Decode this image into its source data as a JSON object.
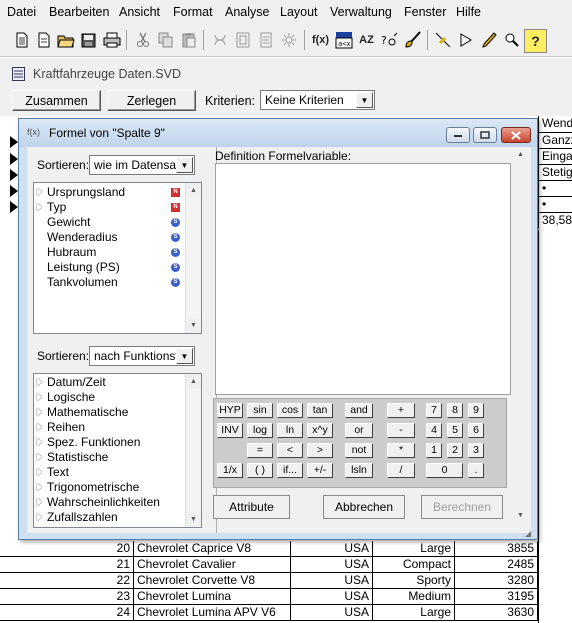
{
  "menu": [
    "Datei",
    "Bearbeiten",
    "Ansicht",
    "Format",
    "Analyse",
    "Layout",
    "Verwaltung",
    "Fenster",
    "Hilfe"
  ],
  "toolbar_icons": [
    "new-file-icon",
    "new-document-icon",
    "open-folder-icon",
    "save-disk-icon",
    "print-icon",
    "cut-icon",
    "copy-icon",
    "paste-icon",
    "formula-sheet-icon",
    "table-icon",
    "page-icon",
    "settings-icon",
    "formula-fx-icon",
    "label-icon",
    "sort-az-icon",
    "variables-icon",
    "brush-icon",
    "line-tool-icon",
    "arrow-tool-icon",
    "pencil-icon",
    "zoom-icon",
    "help-icon"
  ],
  "toolbar_glyphs": {
    "fx": "f(x)",
    "az": "AZ",
    "help": "?"
  },
  "document": {
    "title": "Kraftfahrzeuge Daten.SVD",
    "btn_combine": "Zusammen",
    "btn_split": "Zerlegen",
    "criteria_label": "Kriterien:",
    "criteria_value": "Keine Kriterien"
  },
  "right_column": {
    "header": "Wend",
    "cells": [
      "Ganzz",
      "Einga",
      "Stetig",
      "•",
      "•",
      "38,58"
    ]
  },
  "table_rows": [
    {
      "n": "20",
      "name": "Chevrolet Caprice V8",
      "country": "USA",
      "class": "Large",
      "value": "3855"
    },
    {
      "n": "21",
      "name": "Chevrolet Cavalier",
      "country": "USA",
      "class": "Compact",
      "value": "2485"
    },
    {
      "n": "22",
      "name": "Chevrolet Corvette V8",
      "country": "USA",
      "class": "Sporty",
      "value": "3280"
    },
    {
      "n": "23",
      "name": "Chevrolet Lumina",
      "country": "USA",
      "class": "Medium",
      "value": "3195"
    },
    {
      "n": "24",
      "name": "Chevrolet Lumina APV V6",
      "country": "USA",
      "class": "Large",
      "value": "3630"
    }
  ],
  "dialog": {
    "title_icon": "f(x)",
    "title": "Formel von \"Spalte 9\"",
    "sort_label_1": "Sortieren:",
    "sort_value_1": "wie im Datensatz",
    "variables": [
      {
        "label": "Ursprungsland",
        "expand": true,
        "badge": "N",
        "badge_color": "#d03030"
      },
      {
        "label": "Typ",
        "expand": true,
        "badge": "N",
        "badge_color": "#d03030"
      },
      {
        "label": "Gewicht",
        "expand": false,
        "badge": "S",
        "badge_color": "#3a5fcd"
      },
      {
        "label": "Wenderadius",
        "expand": false,
        "badge": "S",
        "badge_color": "#3a5fcd"
      },
      {
        "label": "Hubraum",
        "expand": false,
        "badge": "S",
        "badge_color": "#3a5fcd"
      },
      {
        "label": "Leistung (PS)",
        "expand": false,
        "badge": "S",
        "badge_color": "#3a5fcd"
      },
      {
        "label": "Tankvolumen",
        "expand": false,
        "badge": "S",
        "badge_color": "#3a5fcd"
      }
    ],
    "sort_label_2": "Sortieren:",
    "sort_value_2": "nach Funktionstyp",
    "functions": [
      "Datum/Zeit",
      "Logische",
      "Mathematische",
      "Reihen",
      "Spez. Funktionen",
      "Statistische",
      "Text",
      "Trigonometrische",
      "Wahrscheinlichkeiten",
      "Zufallszahlen"
    ],
    "definition_label": "Definition Formelvariable:",
    "keypad": {
      "row1": [
        "HYP",
        "sin",
        "cos",
        "tan",
        "and",
        "+",
        "7",
        "8",
        "9"
      ],
      "row2": [
        "INV",
        "log",
        "ln",
        "x^y",
        "or",
        "-",
        "4",
        "5",
        "6"
      ],
      "row3": [
        "=",
        "<",
        ">",
        "not",
        "*",
        "1",
        "2",
        "3"
      ],
      "row4": [
        "1/x",
        "( )",
        "if...",
        "+/-",
        "lsln",
        "/",
        "0",
        "."
      ]
    },
    "btn_attributes": "Attribute",
    "btn_cancel": "Abbrechen",
    "btn_compute": "Berechnen"
  }
}
